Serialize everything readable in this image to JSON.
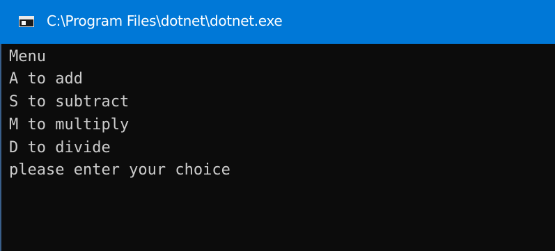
{
  "window": {
    "title": "C:\\Program Files\\dotnet\\dotnet.exe",
    "icon": "console-app-icon"
  },
  "console": {
    "lines": [
      "Menu",
      "A to add",
      "S to subtract",
      "M to multiply",
      "D to divide",
      "please enter your choice"
    ]
  },
  "colors": {
    "titlebar": "#0078d7",
    "background": "#0c0c0c",
    "text": "#cccccc"
  }
}
